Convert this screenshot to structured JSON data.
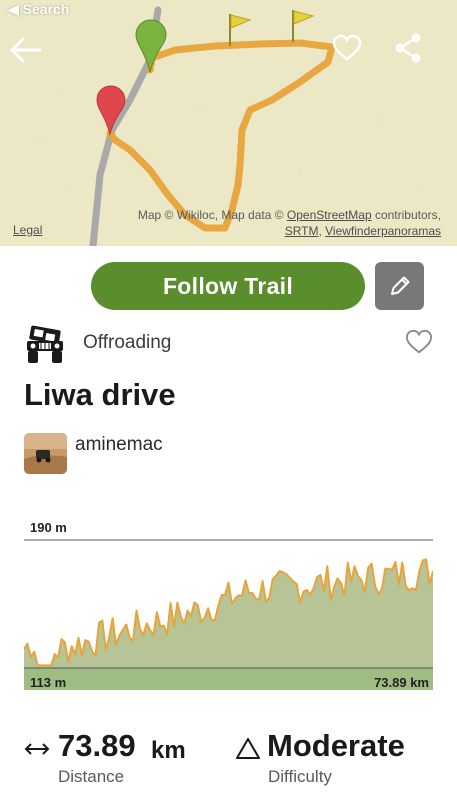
{
  "status_bar": {
    "back_label": "◀ Search"
  },
  "map": {
    "attribution_prefix": "Map © Wikiloc, Map data © ",
    "attribution_link1": "OpenStreetMap",
    "attribution_mid": " contributors,",
    "attribution_link2": "SRTM",
    "attribution_sep": ", ",
    "attribution_link3": "Viewfinderpanoramas",
    "legal_label": "Legal",
    "route_color": "#e8a33a",
    "start_marker_color": "#7bb33f",
    "end_marker_color": "#e0474c"
  },
  "actions": {
    "follow_label": "Follow Trail",
    "follow_color": "#5a8d2c",
    "edit_icon": "pencil-icon"
  },
  "trail": {
    "activity": "Offroading",
    "activity_icon": "jeep-icon",
    "title": "Liwa drive",
    "author": "aminemac"
  },
  "elevation": {
    "max_label": "190 m",
    "min_label": "113 m",
    "distance_label": "73.89 km"
  },
  "stats": {
    "distance_value": "73.89",
    "distance_unit": "km",
    "distance_label": "Distance",
    "difficulty_value": "Moderate",
    "difficulty_label": "Difficulty"
  }
}
